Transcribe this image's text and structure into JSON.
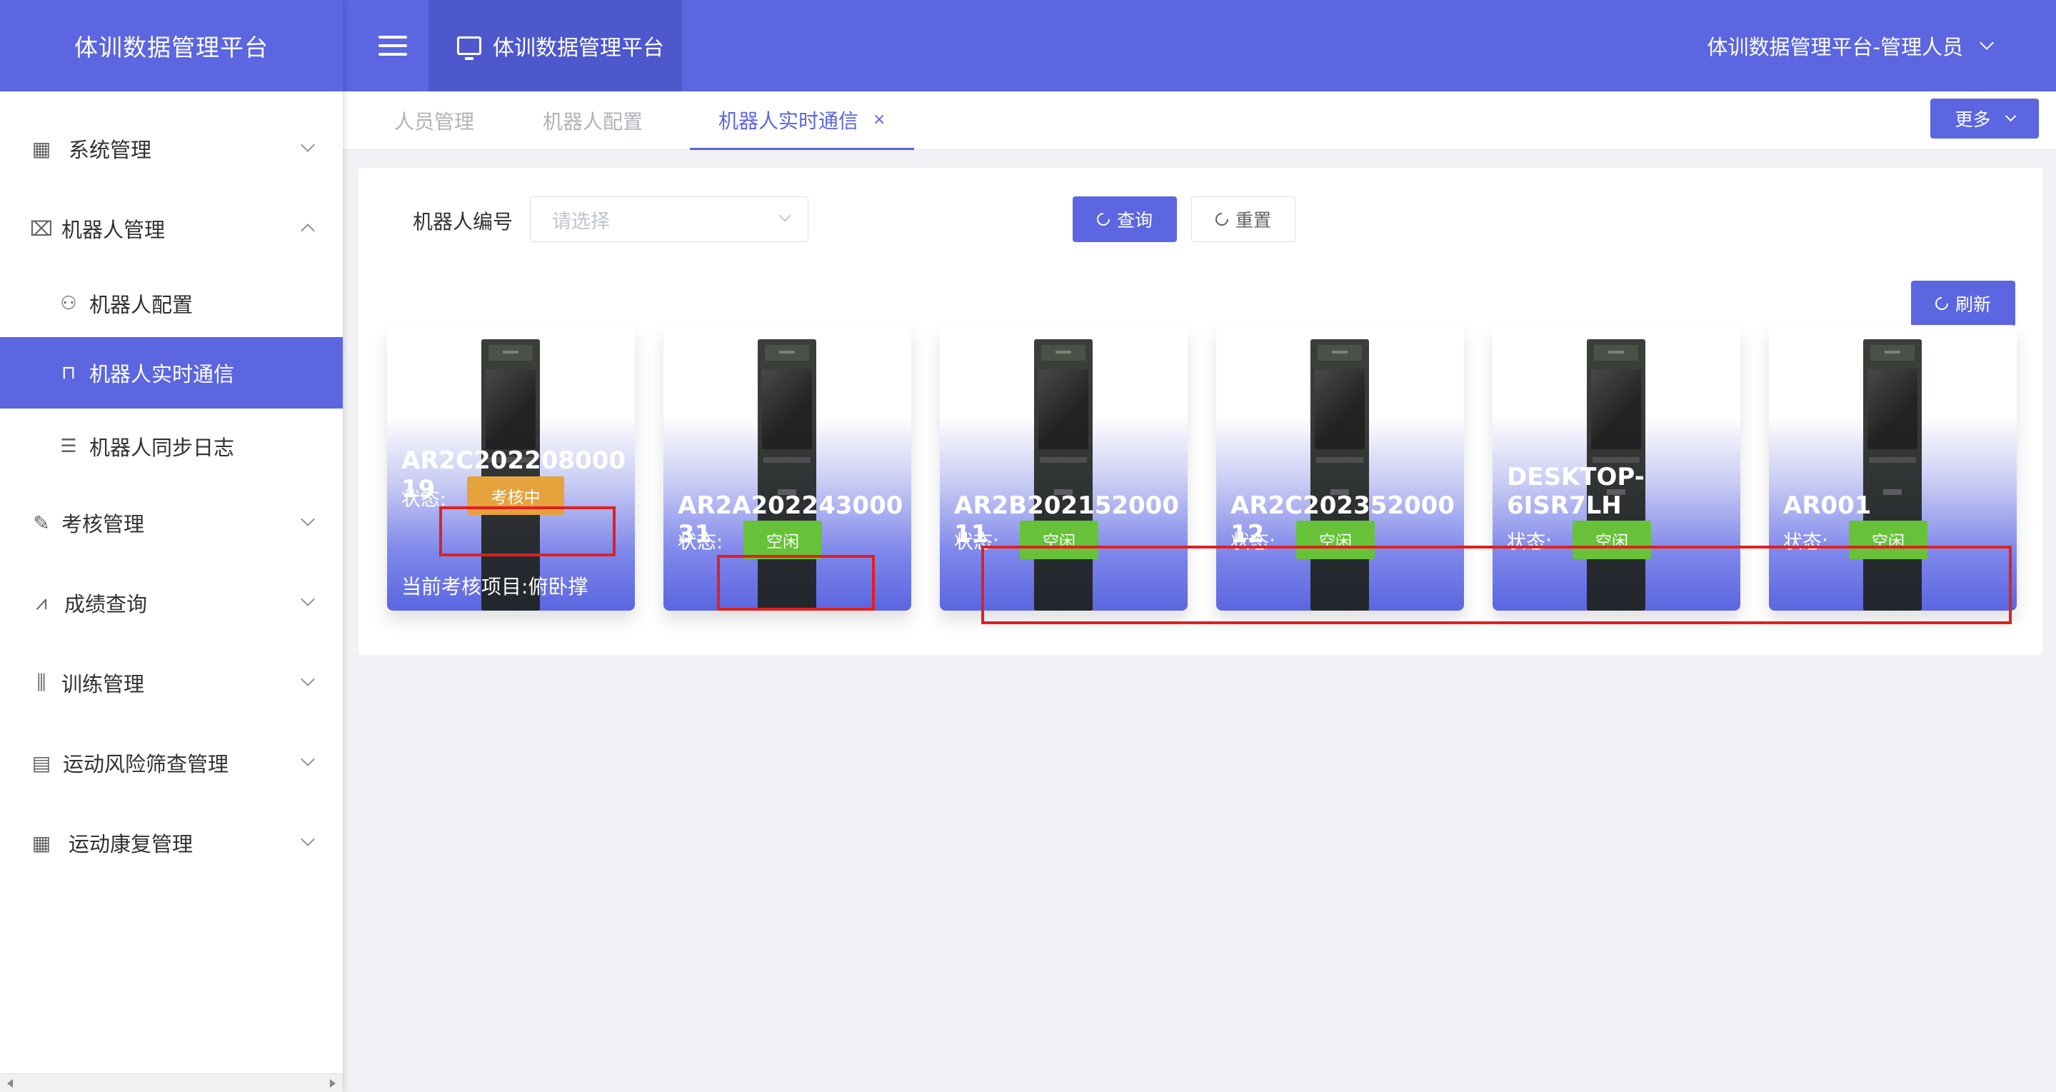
{
  "app": {
    "title": "体训数据管理平台"
  },
  "header": {
    "tab_label": "体训数据管理平台",
    "user_label": "体训数据管理平台-管理人员"
  },
  "sidebar": {
    "items": [
      {
        "label": "系统管理",
        "icon": "grid-icon",
        "expanded": false
      },
      {
        "label": "机器人管理",
        "icon": "monitor-chart-icon",
        "expanded": true,
        "children": [
          {
            "label": "机器人配置",
            "icon": "tree-icon",
            "active": false
          },
          {
            "label": "机器人实时通信",
            "icon": "bag-icon",
            "active": true
          },
          {
            "label": "机器人同步日志",
            "icon": "list-icon",
            "active": false
          }
        ]
      },
      {
        "label": "考核管理",
        "icon": "edit-icon",
        "expanded": false
      },
      {
        "label": "成绩查询",
        "icon": "chart-line-icon",
        "expanded": false
      },
      {
        "label": "训练管理",
        "icon": "sliders-icon",
        "expanded": false
      },
      {
        "label": "运动风险筛查管理",
        "icon": "doc-icon",
        "expanded": false
      },
      {
        "label": "运动康复管理",
        "icon": "grid-icon",
        "expanded": false
      }
    ]
  },
  "tabs": {
    "items": [
      {
        "label": "人员管理",
        "active": false
      },
      {
        "label": "机器人配置",
        "active": false
      },
      {
        "label": "机器人实时通信",
        "active": true,
        "close": "×"
      }
    ],
    "more_label": "更多"
  },
  "filter": {
    "label": "机器人编号",
    "placeholder": "请选择",
    "query_label": "查询",
    "reset_label": "重置",
    "refresh_label": "刷新"
  },
  "robots": [
    {
      "id": "AR2C20220800019",
      "status_label": "状态:",
      "status": "考核中",
      "current_label": "当前考核项目:",
      "current_item": "俯卧撑"
    },
    {
      "id": "AR2A20224300031",
      "status_label": "状态:",
      "status": "空闲"
    },
    {
      "id": "AR2B20215200011",
      "status_label": "状态:",
      "status": "空闲"
    },
    {
      "id": "AR2C20235200012",
      "status_label": "状态:",
      "status": "空闲"
    },
    {
      "id": "DESKTOP-6ISR7LH",
      "status_label": "状态:",
      "status": "空闲"
    },
    {
      "id": "AR001",
      "status_label": "状态:",
      "status": "空闲"
    }
  ],
  "colors": {
    "primary": "#5b66e0",
    "busy": "#e6a23c",
    "idle": "#67c23a",
    "annotation": "#e02020"
  }
}
